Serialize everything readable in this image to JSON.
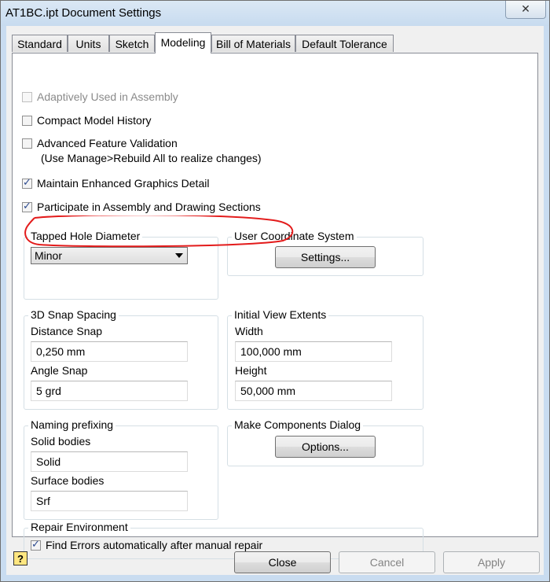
{
  "window": {
    "title": "AT1BC.ipt Document Settings",
    "close_glyph": "✕"
  },
  "tabs": [
    {
      "label": "Standard",
      "active": false
    },
    {
      "label": "Units",
      "active": false
    },
    {
      "label": "Sketch",
      "active": false
    },
    {
      "label": "Modeling",
      "active": true
    },
    {
      "label": "Bill of Materials",
      "active": false
    },
    {
      "label": "Default Tolerance",
      "active": false
    }
  ],
  "options": {
    "adaptively_used": {
      "label": "Adaptively Used in Assembly",
      "checked": false,
      "enabled": false
    },
    "compact_history": {
      "label": "Compact Model History",
      "checked": false
    },
    "advanced_validation": {
      "label": "Advanced Feature Validation",
      "checked": false,
      "note": "(Use Manage>Rebuild All to realize changes)"
    },
    "enhanced_graphics": {
      "label": "Maintain Enhanced Graphics Detail",
      "checked": true
    },
    "participate_sections": {
      "label": "Participate in Assembly and Drawing Sections",
      "checked": true
    }
  },
  "tapped_hole": {
    "title": "Tapped Hole Diameter",
    "selected": "Minor"
  },
  "ucs": {
    "title": "User Coordinate System",
    "button": "Settings..."
  },
  "snap": {
    "title": "3D Snap Spacing",
    "distance_label": "Distance Snap",
    "distance_value": "0,250 mm",
    "angle_label": "Angle Snap",
    "angle_value": "5 grd"
  },
  "view_extents": {
    "title": "Initial View Extents",
    "width_label": "Width",
    "width_value": "100,000 mm",
    "height_label": "Height",
    "height_value": "50,000 mm"
  },
  "naming": {
    "title": "Naming prefixing",
    "solid_label": "Solid bodies",
    "solid_value": "Solid",
    "surface_label": "Surface bodies",
    "surface_value": "Srf"
  },
  "make_components": {
    "title": "Make Components Dialog",
    "button": "Options..."
  },
  "repair": {
    "title": "Repair Environment",
    "find_errors": {
      "label": "Find Errors automatically after manual repair",
      "checked": true
    }
  },
  "footer": {
    "help": "?",
    "close": "Close",
    "cancel": "Cancel",
    "apply": "Apply"
  },
  "annotation": {
    "color": "#e31b1b"
  }
}
